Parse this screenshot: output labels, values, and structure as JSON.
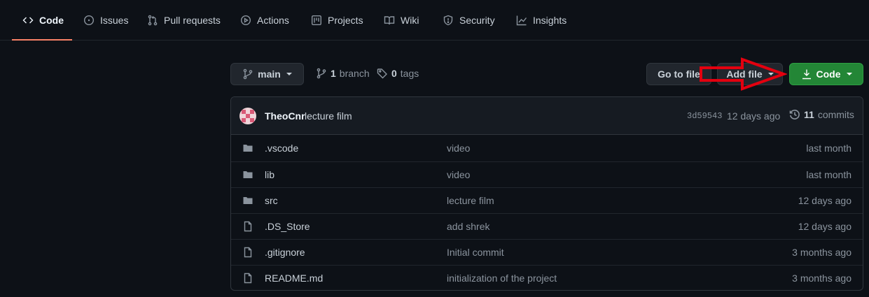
{
  "nav": {
    "tabs": [
      {
        "label": "Code",
        "icon": "code-icon"
      },
      {
        "label": "Issues",
        "icon": "issue-icon"
      },
      {
        "label": "Pull requests",
        "icon": "pull-request-icon"
      },
      {
        "label": "Actions",
        "icon": "play-icon"
      },
      {
        "label": "Projects",
        "icon": "project-icon"
      },
      {
        "label": "Wiki",
        "icon": "book-icon"
      },
      {
        "label": "Security",
        "icon": "shield-icon"
      },
      {
        "label": "Insights",
        "icon": "graph-icon"
      }
    ],
    "active_color": "#f78166"
  },
  "toolbar": {
    "branch": "main",
    "branch_count": "1",
    "branch_word": "branch",
    "tag_count": "0",
    "tag_word": "tags",
    "go_to_file": "Go to file",
    "add_file": "Add file",
    "code": "Code",
    "code_color": "#238636"
  },
  "commit": {
    "author": "TheoCnr",
    "message": "lecture film",
    "sha": "3d59543",
    "time": "12 days ago",
    "count": "11",
    "count_word": "commits"
  },
  "files": [
    {
      "type": "folder",
      "name": ".vscode",
      "message": "video",
      "time": "last month"
    },
    {
      "type": "folder",
      "name": "lib",
      "message": "video",
      "time": "last month"
    },
    {
      "type": "folder",
      "name": "src",
      "message": "lecture film",
      "time": "12 days ago"
    },
    {
      "type": "file",
      "name": ".DS_Store",
      "message": "add shrek",
      "time": "12 days ago"
    },
    {
      "type": "file",
      "name": ".gitignore",
      "message": "Initial commit",
      "time": "3 months ago"
    },
    {
      "type": "file",
      "name": "README.md",
      "message": "initialization of the project",
      "time": "3 months ago"
    }
  ],
  "annotation": {
    "color": "#e3000f"
  }
}
